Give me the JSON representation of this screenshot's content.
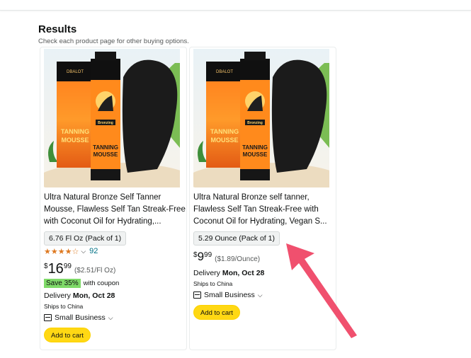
{
  "header": {
    "results_title": "Results",
    "results_subtitle": "Check each product page for other buying options."
  },
  "products": [
    {
      "title": "Ultra Natural Bronze Self Tanner Mousse, Flawless Self Tan Streak-Free with Coconut Oil for Hydrating,...",
      "size": "6.76 Fl Oz (Pack of 1)",
      "rating_stars": "★★★★☆",
      "rating_value": 4,
      "rating_count": "92",
      "price_symbol": "$",
      "price_whole": "16",
      "price_fraction": "99",
      "unit_price": "($2.51/Fl Oz)",
      "coupon_badge": "Save 35%",
      "coupon_text": "with coupon",
      "delivery_label": "Delivery",
      "delivery_date": "Mon, Oct 28",
      "ships_to": "Ships to China",
      "small_business": "Small Business",
      "add_to_cart": "Add to cart",
      "image_text": {
        "brand": "DBALOT",
        "product": "TANNING",
        "product2": "MOUSSE",
        "label": "Bronzing"
      }
    },
    {
      "title": "Ultra Natural Bronze self tanner, Flawless Self Tan Streak-Free with Coconut Oil for Hydrating, Vegan S...",
      "size": "5.29 Ounce (Pack of 1)",
      "price_symbol": "$",
      "price_whole": "9",
      "price_fraction": "99",
      "unit_price": "($1.89/Ounce)",
      "delivery_label": "Delivery",
      "delivery_date": "Mon, Oct 28",
      "ships_to": "Ships to China",
      "small_business": "Small Business",
      "add_to_cart": "Add to cart",
      "image_text": {
        "brand": "DBALOT",
        "product": "TANNING",
        "product2": "MOUSSE",
        "label": "Bronzing"
      }
    }
  ],
  "icons": {
    "chevron": "chevron-down-icon",
    "small_business": "small-business-icon",
    "annotation_arrow": "arrow-icon"
  },
  "colors": {
    "add_to_cart": "#ffd814",
    "coupon_badge": "#7fda69",
    "stars": "#de7921",
    "link": "#007185",
    "annotation_arrow": "#f0506e"
  }
}
